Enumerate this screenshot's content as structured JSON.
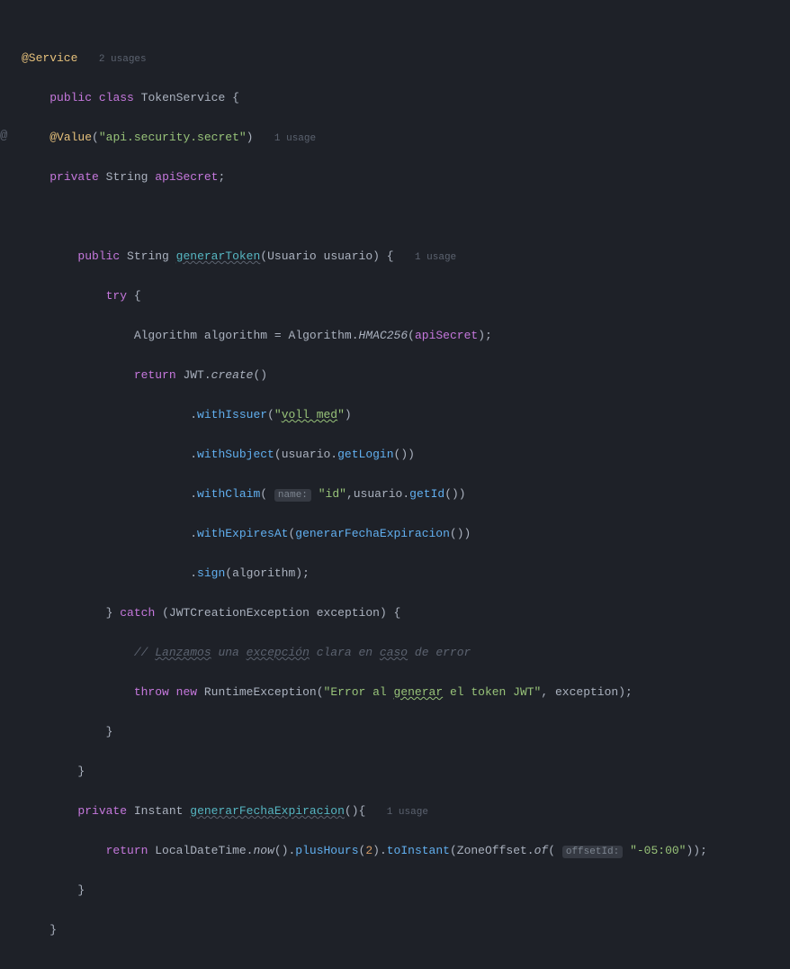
{
  "usage_hints": {
    "service": "2 usages",
    "value": "1 usage",
    "generarToken": "1 usage",
    "generarFecha": "1 usage"
  },
  "inlay": {
    "name": "name:",
    "offsetId": "offsetId:"
  },
  "annotations": {
    "service": "@Service",
    "value": "@Value"
  },
  "keywords": {
    "public": "public",
    "class": "class",
    "private": "private",
    "try": "try",
    "return": "return",
    "catch": "catch",
    "throw": "throw",
    "new": "new"
  },
  "types": {
    "TokenService": "TokenService",
    "String": "String",
    "Usuario": "Usuario",
    "Algorithm": "Algorithm",
    "JWTCreationException": "JWTCreationException",
    "RuntimeException": "RuntimeException",
    "Instant": "Instant",
    "LocalDateTime": "LocalDateTime",
    "ZoneOffset": "ZoneOffset",
    "JWT": "JWT"
  },
  "identifiers": {
    "apiSecret": "apiSecret",
    "generarToken": "generarToken",
    "usuario": "usuario",
    "algorithm": "algorithm",
    "exception": "exception",
    "generarFechaExpiracion": "generarFechaExpiracion"
  },
  "methods": {
    "HMAC256": "HMAC256",
    "create": "create",
    "withIssuer": "withIssuer",
    "withSubject": "withSubject",
    "getLogin": "getLogin",
    "withClaim": "withClaim",
    "getId": "getId",
    "withExpiresAt": "withExpiresAt",
    "sign": "sign",
    "now": "now",
    "plusHours": "plusHours",
    "toInstant": "toInstant",
    "of": "of"
  },
  "strings": {
    "apiSecurity": "\"api.security.secret\"",
    "vollMed_open": "\"",
    "vollMed_text": "voll med",
    "vollMed_close": "\"",
    "id": "\"id\"",
    "error_open": "\"Error al ",
    "error_generar": "generar",
    "error_close": " el token JWT\"",
    "offset": "\"-05:00\""
  },
  "numbers": {
    "two": "2"
  },
  "comment": {
    "prefix": "// ",
    "lanzamos": "Lanzamos",
    "una": " una ",
    "excepcion": "excepción",
    "clara": " clara en ",
    "caso": "caso",
    "error": " de error"
  }
}
